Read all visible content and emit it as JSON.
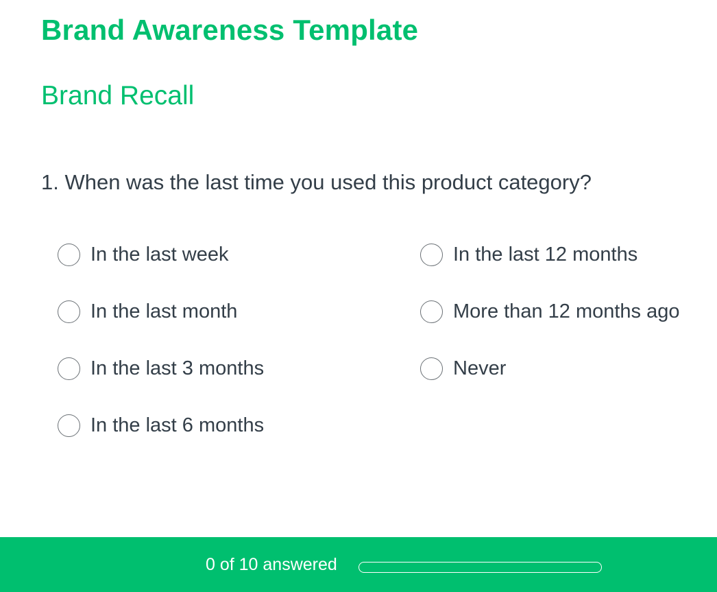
{
  "survey": {
    "title": "Brand Awareness Template",
    "page_title": "Brand Recall"
  },
  "question": {
    "number": "1.",
    "text": "1. When was the last time you used this product category?",
    "options_left": [
      {
        "label": "In the last week",
        "selected": false
      },
      {
        "label": "In the last month",
        "selected": false
      },
      {
        "label": "In the last 3 months",
        "selected": false
      },
      {
        "label": "In the last 6 months",
        "selected": false
      }
    ],
    "options_right": [
      {
        "label": "In the last 12 months",
        "selected": false
      },
      {
        "label": "More than 12 months ago",
        "selected": false
      },
      {
        "label": "Never",
        "selected": false
      }
    ]
  },
  "footer": {
    "progress_text": "0 of 10 answered",
    "answered": 0,
    "total": 10,
    "progress_fraction": 0
  },
  "colors": {
    "accent": "#00bf6f",
    "text": "#333e48",
    "radio_border": "#6b7176"
  }
}
